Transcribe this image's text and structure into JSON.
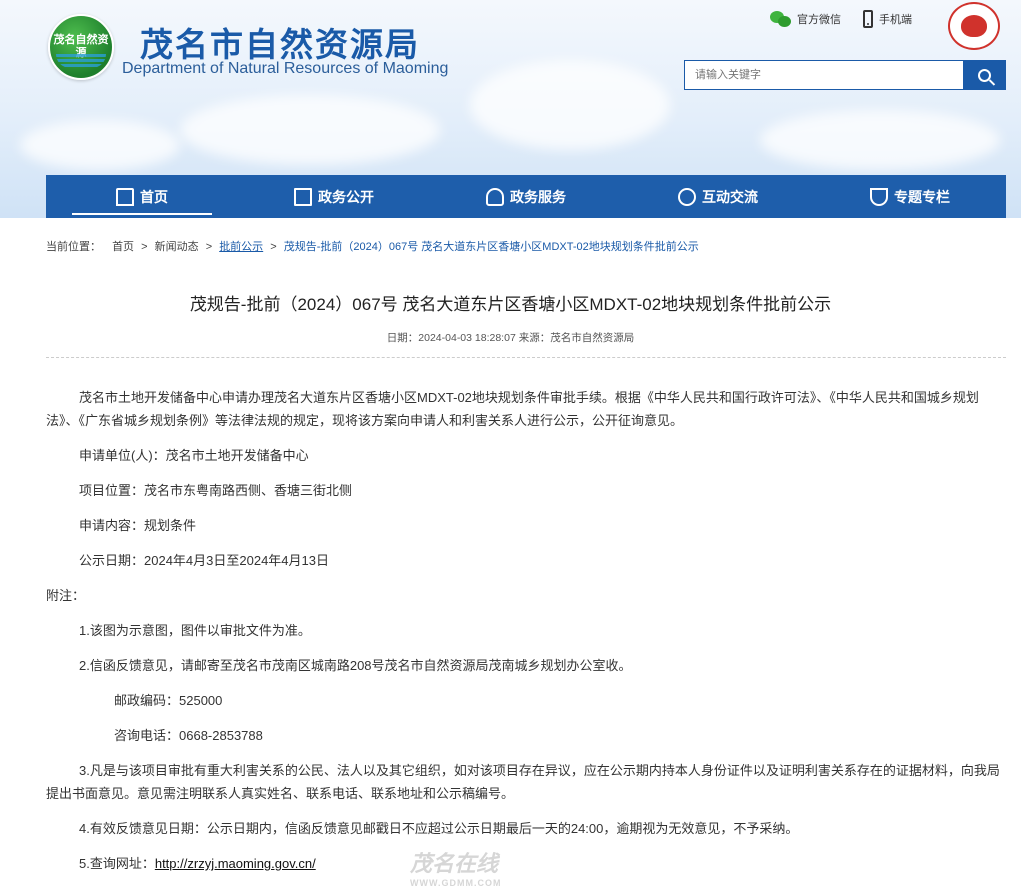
{
  "header": {
    "logo_text": "茂名自然资源",
    "title": "茂名市自然资源局",
    "subtitle": "Department of Natural Resources of Maoming",
    "top_links": [
      {
        "label": "官方微信",
        "icon": "wechat-icon"
      },
      {
        "label": "手机端",
        "icon": "phone-icon"
      }
    ],
    "search": {
      "placeholder": "请输入关键字"
    }
  },
  "nav": {
    "items": [
      {
        "label": "首页",
        "icon": "home-icon",
        "active": true
      },
      {
        "label": "政务公开",
        "icon": "document-icon"
      },
      {
        "label": "政务服务",
        "icon": "user-service-icon"
      },
      {
        "label": "互动交流",
        "icon": "chat-icon"
      },
      {
        "label": "专题专栏",
        "icon": "trophy-icon"
      }
    ]
  },
  "breadcrumb": {
    "prefix": "当前位置：",
    "items": [
      "首页",
      "新闻动态",
      "批前公示",
      "茂规告-批前（2024）067号 茂名大道东片区香塘小区MDXT-02地块规划条件批前公示"
    ],
    "separator": ">"
  },
  "article": {
    "title": "茂规告-批前（2024）067号 茂名大道东片区香塘小区MDXT-02地块规划条件批前公示",
    "meta": "日期：2024-04-03 18:28:07   来源：茂名市自然资源局",
    "paragraphs": [
      "茂名市土地开发储备中心申请办理茂名大道东片区香塘小区MDXT-02地块规划条件审批手续。根据《中华人民共和国行政许可法》、《中华人民共和国城乡规划法》、《广东省城乡规划条例》等法律法规的规定，现将该方案向申请人和利害关系人进行公示，公开征询意见。",
      "申请单位(人)：茂名市土地开发储备中心",
      "项目位置：茂名市东粤南路西侧、香塘三街北侧",
      "申请内容：规划条件",
      "公示日期：2024年4月3日至2024年4月13日"
    ],
    "notes_label": "附注：",
    "notes": [
      "1.该图为示意图，图件以审批文件为准。",
      "2.信函反馈意见，请邮寄至茂名市茂南区城南路208号茂名市自然资源局茂南城乡规划办公室收。"
    ],
    "postcode": "邮政编码：525000",
    "phone": "咨询电话：0668-2853788",
    "notes_more": [
      "3.凡是与该项目审批有重大利害关系的公民、法人以及其它组织，如对该项目存在异议，应在公示期内持本人身份证件以及证明利害关系存在的证据材料，向我局提出书面意见。意见需注明联系人真实姓名、联系电话、联系地址和公示稿编号。",
      "4.有效反馈意见日期：公示日期内，信函反馈意见邮戳日不应超过公示日期最后一天的24:00，逾期视为无效意见，不予采纳。"
    ],
    "url_label": "5.查询网址：",
    "url": "http://zrzyj.maoming.gov.cn/"
  },
  "watermark": {
    "text": "茂名在线",
    "sub": "WWW.GDMM.COM"
  },
  "colors": {
    "brand": "#1e5eab",
    "title_blue": "#1a5aa8",
    "logo_green": "#1e7f2c",
    "emblem_red": "#d0322c"
  }
}
